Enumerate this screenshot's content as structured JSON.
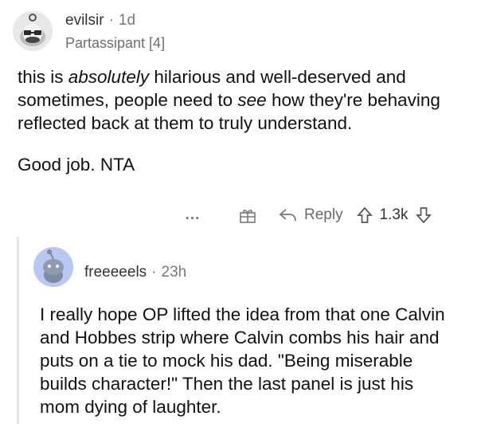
{
  "comment": {
    "author": "evilsir",
    "separator": "·",
    "age": "1d",
    "flair": "Partassipant [4]",
    "body_parts": [
      "this is ",
      "absolutely",
      " hilarious and well-deserved and sometimes, people need to ",
      "see",
      " how they're behaving reflected back at them to truly understand."
    ],
    "body_second": "Good job. NTA",
    "actions": {
      "more_label": "...",
      "reply_label": "Reply",
      "score": "1.3k"
    }
  },
  "reply": {
    "author": "freeeeels",
    "separator": "·",
    "age": "23h",
    "body": "I really hope OP lifted the idea from that one Calvin and Hobbes strip where Calvin combs his hair and puts on a tie to mock his dad. \"Being miserable builds character!\" Then the last panel is just his mom dying of laughter."
  },
  "icons": {
    "avatar_top": "snoo-avatar-icon",
    "avatar_reply": "snoo-avatar-icon",
    "award": "gift-icon",
    "reply": "reply-arrow-icon",
    "upvote": "upvote-arrow-icon",
    "downvote": "downvote-arrow-icon"
  },
  "colors": {
    "reply_avatar_bg": "#b9c7f2",
    "thread_line": "#e5e5e5"
  }
}
